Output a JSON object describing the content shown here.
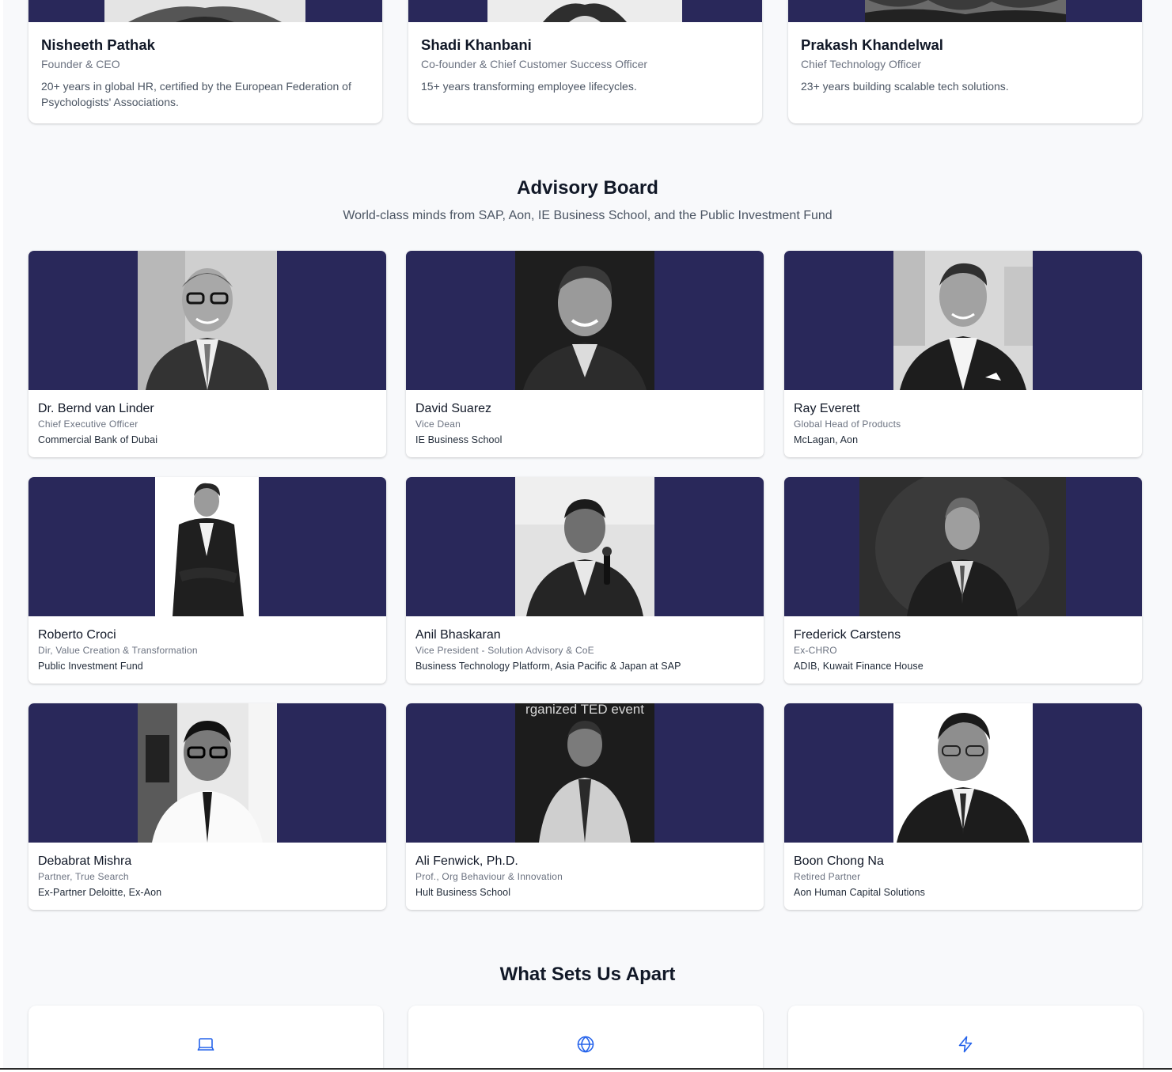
{
  "leadership": [
    {
      "name": "Nisheeth Pathak",
      "role": "Founder & CEO",
      "description": "20+ years in global HR, certified by the European Federation of Psychologists' Associations."
    },
    {
      "name": "Shadi Khanbani",
      "role": "Co-founder & Chief Customer Success Officer",
      "description": "15+ years transforming employee lifecycles."
    },
    {
      "name": "Prakash Khandelwal",
      "role": "Chief Technology Officer",
      "description": "23+ years building scalable tech solutions."
    }
  ],
  "advisory": {
    "title": "Advisory Board",
    "subtitle": "World-class minds from SAP, Aon, IE Business School, and the Public Investment Fund",
    "members": [
      {
        "name": "Dr. Bernd van Linder",
        "title": "Chief Executive Officer",
        "org": "Commercial Bank of Dubai"
      },
      {
        "name": "David Suarez",
        "title": "Vice Dean",
        "org": "IE Business School"
      },
      {
        "name": "Ray Everett",
        "title": "Global Head of Products",
        "org": "McLagan, Aon"
      },
      {
        "name": "Roberto Croci",
        "title": "Dir, Value Creation & Transformation",
        "org": "Public Investment Fund"
      },
      {
        "name": "Anil Bhaskaran",
        "title": "Vice President - Solution Advisory & CoE",
        "org": "Business Technology Platform, Asia Pacific & Japan at SAP"
      },
      {
        "name": "Frederick Carstens",
        "title": "Ex-CHRO",
        "org": "ADIB, Kuwait Finance House"
      },
      {
        "name": "Debabrat Mishra",
        "title": "Partner, True Search",
        "org": "Ex-Partner Deloitte, Ex-Aon"
      },
      {
        "name": "Ali Fenwick, Ph.D.",
        "title": "Prof., Org Behaviour & Innovation",
        "org": "Hult Business School"
      },
      {
        "name": "Boon Chong Na",
        "title": "Retired Partner",
        "org": "Aon Human Capital Solutions"
      }
    ],
    "photo_caption_ali": "rganized TED event"
  },
  "features": {
    "title": "What Sets Us Apart",
    "icons": [
      "laptop-icon",
      "globe-icon",
      "lightning-icon"
    ]
  },
  "colors": {
    "band": "#29285a",
    "accent_icon": "#2563eb",
    "page_bg": "#f8f9fb"
  }
}
